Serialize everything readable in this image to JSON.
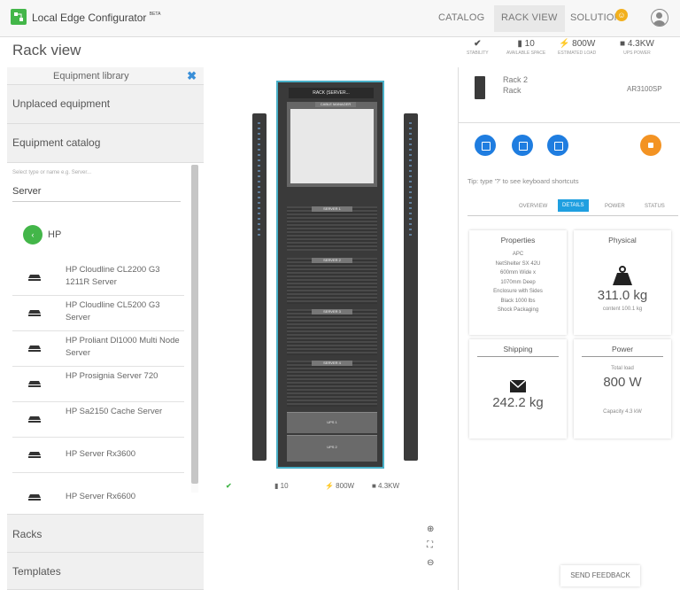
{
  "app": {
    "title": "Local Edge Configurator",
    "beta": "BETA"
  },
  "nav": {
    "catalog": "CATALOG",
    "rackview": "RACK VIEW",
    "solution": "SOLUTION",
    "solution_badge": "☺"
  },
  "page": {
    "title": "Rack view"
  },
  "stats": [
    {
      "value": "✔",
      "label": "stability"
    },
    {
      "value": "▮ 10",
      "label": "available space"
    },
    {
      "value": "⚡ 800W",
      "label": "estimated load"
    },
    {
      "value": "■ 4.3KW",
      "label": "ups power"
    }
  ],
  "library": {
    "title": "Equipment library",
    "close": "✖",
    "unplaced": "Unplaced equipment",
    "catalog": "Equipment catalog",
    "search_placeholder": "Select type or name e.g. Server...",
    "search_value": "Server",
    "crumb_back": "‹",
    "crumb": "HP",
    "items": [
      "HP Cloudline CL2200 G3 1211R Server",
      "HP Cloudline CL5200 G3 Server",
      "HP Proliant Dl1000 Multi Node Server",
      "HP Prosignia Server 720",
      "HP Sa2150 Cache Server",
      "HP Server Rx3600",
      "HP Server Rx6600"
    ],
    "racks": "Racks",
    "templates": "Templates"
  },
  "rack": {
    "title": "RACK (SERVER...",
    "equipment_labels": [
      "CABLE MANAGER",
      "SERVER 1",
      "SERVER 2",
      "SERVER 3",
      "SERVER 4",
      "UPS 1",
      "UPS 2"
    ],
    "stats": {
      "check": "✔",
      "space": "▮ 10",
      "load": "⚡ 800W",
      "power": "■ 4.3KW"
    },
    "zoom_in": "⊕",
    "fit": "⛶",
    "zoom_out": "⊖"
  },
  "detail": {
    "name": "Rack 2",
    "type": "Rack",
    "code": "AR3100SP",
    "tip": "Tip: type '?' to see keyboard shortcuts",
    "tabs": [
      "OVERVIEW",
      "DETAILS",
      "POWER",
      "STATUS"
    ],
    "properties": {
      "title": "Properties",
      "lines": [
        "APC",
        "NetShelter SX 42U",
        "600mm Wide x",
        "1070mm Deep",
        "Enclosure with Sides",
        "Black 1000 lbs",
        "Shock Packaging"
      ]
    },
    "physical": {
      "title": "Physical",
      "value": "311.0 kg",
      "sub": "content 100.1 kg"
    },
    "shipping": {
      "title": "Shipping",
      "value": "242.2 kg"
    },
    "power": {
      "title": "Power",
      "sub1": "Total load",
      "value": "800 W",
      "sub2": "Capacity 4.3 kW"
    },
    "feedback": "SEND FEEDBACK"
  }
}
